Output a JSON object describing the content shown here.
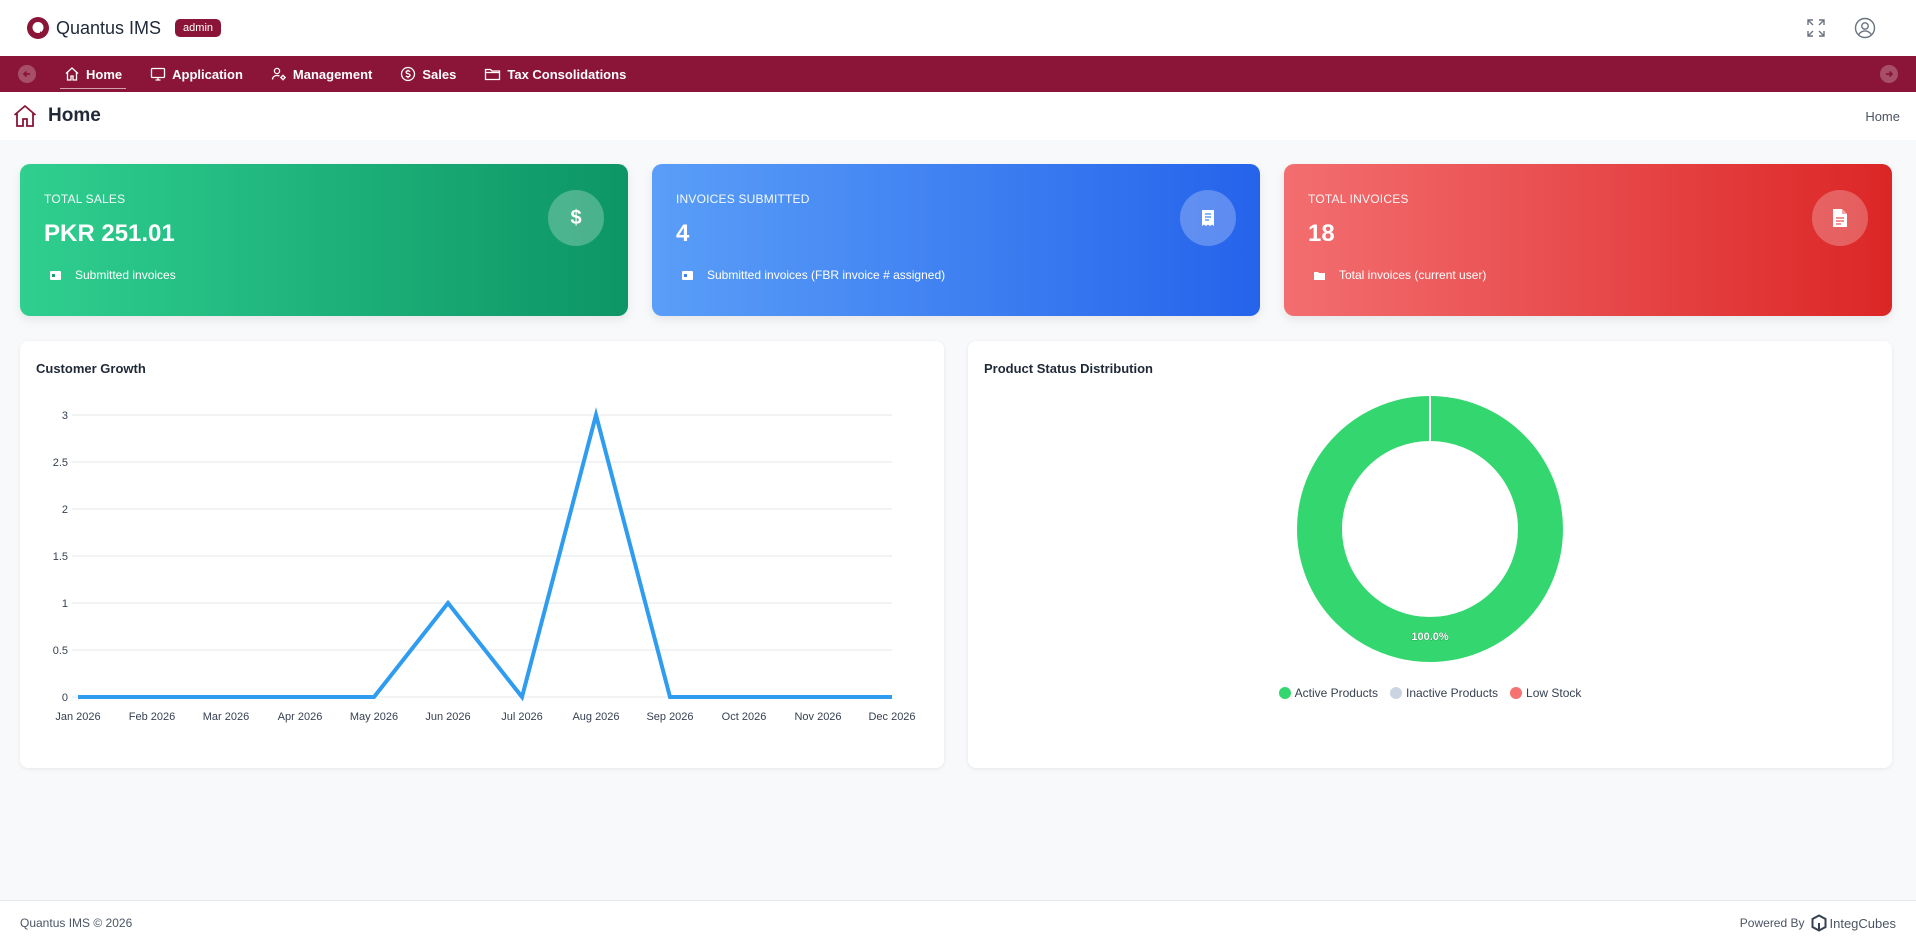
{
  "app": {
    "name": "Quantus IMS",
    "role_badge": "admin"
  },
  "nav": {
    "items": [
      {
        "label": "Home",
        "icon": "home-icon",
        "active": true
      },
      {
        "label": "Application",
        "icon": "monitor-icon"
      },
      {
        "label": "Management",
        "icon": "users-gear-icon"
      },
      {
        "label": "Sales",
        "icon": "dollar-circle-icon"
      },
      {
        "label": "Tax Consolidations",
        "icon": "folder-icon"
      }
    ]
  },
  "page": {
    "title": "Home",
    "breadcrumb": "Home"
  },
  "cards": [
    {
      "label": "TOTAL SALES",
      "value": "PKR 251.01",
      "sub": "Submitted invoices",
      "icon": "dollar-icon",
      "color": "#10a36e"
    },
    {
      "label": "INVOICES SUBMITTED",
      "value": "4",
      "sub": "Submitted invoices (FBR invoice # assigned)",
      "icon": "receipt-icon",
      "color": "#3b82f6"
    },
    {
      "label": "TOTAL INVOICES",
      "value": "18",
      "sub": "Total invoices (current user)",
      "icon": "document-icon",
      "color": "#ef4444"
    }
  ],
  "customer_growth": {
    "title": "Customer Growth",
    "chart_data": {
      "type": "line",
      "categories": [
        "Jan 2026",
        "Feb 2026",
        "Mar 2026",
        "Apr 2026",
        "May 2026",
        "Jun 2026",
        "Jul 2026",
        "Aug 2026",
        "Sep 2026",
        "Oct 2026",
        "Nov 2026",
        "Dec 2026"
      ],
      "values": [
        0,
        0,
        0,
        0,
        0,
        1,
        0,
        3,
        0,
        0,
        0,
        0
      ],
      "ylim": [
        0,
        3
      ],
      "yticks": [
        "0",
        "0.5",
        "1",
        "1.5",
        "2",
        "2.5",
        "3"
      ],
      "color": "#2f9cf0",
      "grid": true
    }
  },
  "product_status": {
    "title": "Product Status Distribution",
    "chart_data": {
      "type": "pie",
      "labels": [
        "Active Products",
        "Inactive Products",
        "Low Stock"
      ],
      "values": [
        100,
        0,
        0
      ],
      "colors": [
        "#34d76f",
        "#cbd5e1",
        "#f87171"
      ],
      "data_label": "100.0%",
      "legend_position": "bottom"
    }
  },
  "footer": {
    "copyright": "Quantus IMS © 2026",
    "powered_by": "Powered By",
    "vendor": "IntegCubes"
  }
}
